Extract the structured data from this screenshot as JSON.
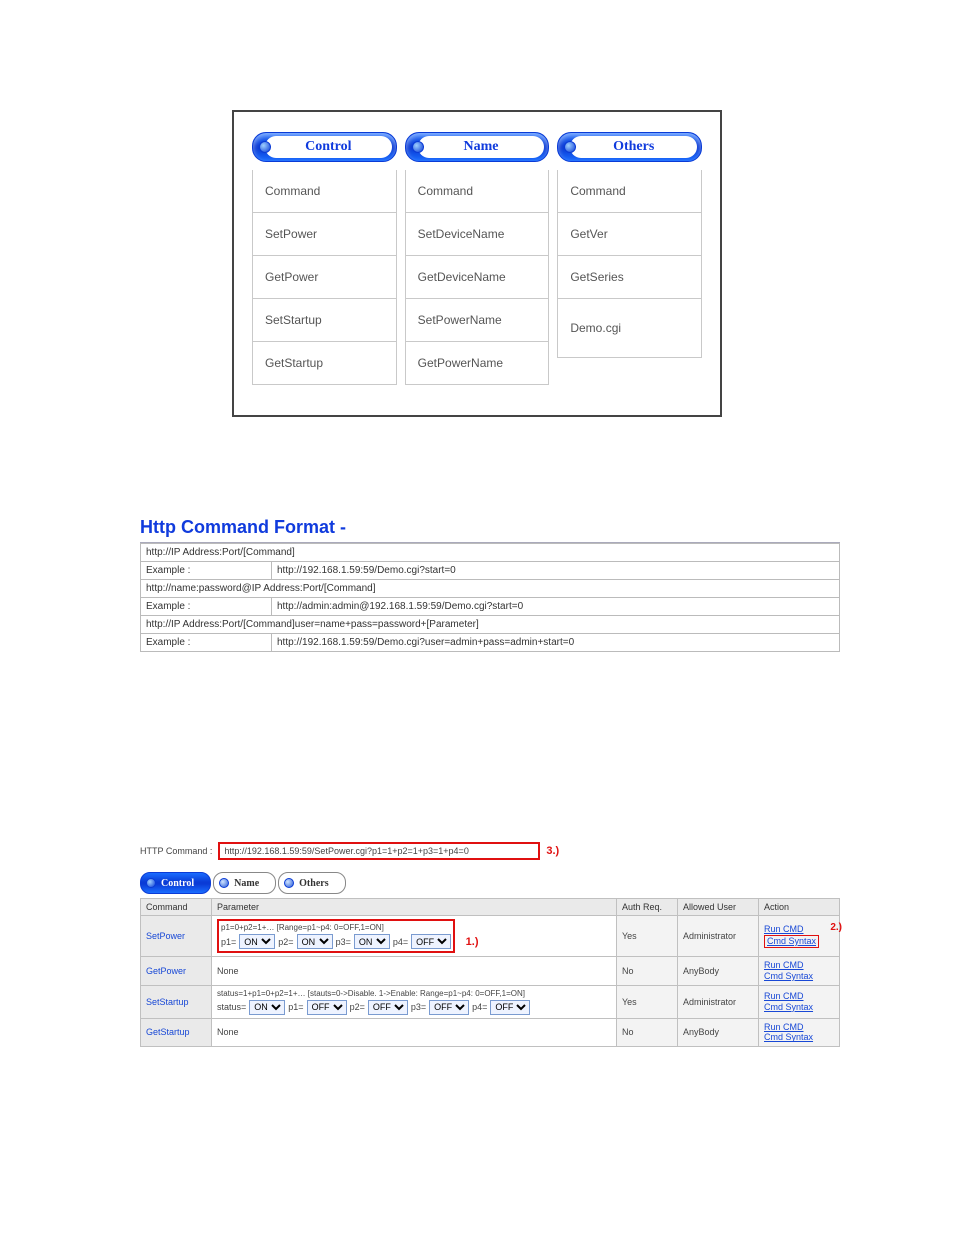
{
  "panel1": {
    "cols": [
      {
        "title": "Control",
        "rows": [
          "Command",
          "SetPower",
          "GetPower",
          "SetStartup",
          "GetStartup"
        ]
      },
      {
        "title": "Name",
        "rows": [
          "Command",
          "SetDeviceName",
          "GetDeviceName",
          "SetPowerName",
          "GetPowerName"
        ]
      },
      {
        "title": "Others",
        "rows": [
          "Command",
          "GetVer",
          "GetSeries",
          "Demo.cgi"
        ]
      }
    ]
  },
  "section2": {
    "title": "Http Command Format -",
    "rows": [
      {
        "span": "http://IP Address:Port/[Command]"
      },
      {
        "label": "Example :",
        "value": "http://192.168.1.59:59/Demo.cgi?start=0"
      },
      {
        "span": "http://name:password@IP Address:Port/[Command]"
      },
      {
        "label": "Example :",
        "value": "http://admin:admin@192.168.1.59:59/Demo.cgi?start=0"
      },
      {
        "span": "http://IP Address:Port/[Command]user=name+pass=password+[Parameter]"
      },
      {
        "label": "Example :",
        "value": "http://192.168.1.59:59/Demo.cgi?user=admin+pass=admin+start=0"
      }
    ]
  },
  "section3": {
    "http_label": "HTTP Command :",
    "http_url": "http://192.168.1.59:59/SetPower.cgi?p1=1+p2=1+p3=1+p4=0",
    "anno3": "3.)",
    "tabs": {
      "control": "Control",
      "name": "Name",
      "others": "Others"
    },
    "headers": {
      "command": "Command",
      "parameter": "Parameter",
      "auth": "Auth Req.",
      "user": "Allowed User",
      "action": "Action"
    },
    "links": {
      "run": "Run CMD",
      "syntax": "Cmd Syntax"
    },
    "anno1": "1.)",
    "anno2": "2.)",
    "rows": [
      {
        "cmd": "SetPower",
        "legend": "p1=0+p2=1+… [Range=p1~p4: 0=OFF,1=ON]",
        "selectors": [
          {
            "lbl": "p1=",
            "val": "ON"
          },
          {
            "lbl": "p2=",
            "val": "ON"
          },
          {
            "lbl": "p3=",
            "val": "ON"
          },
          {
            "lbl": "p4=",
            "val": "OFF"
          }
        ],
        "auth": "Yes",
        "user": "Administrator",
        "anno": "1"
      },
      {
        "cmd": "GetPower",
        "param_text": "None",
        "auth": "No",
        "user": "AnyBody"
      },
      {
        "cmd": "SetStartup",
        "legend": "status=1+p1=0+p2=1+… [stauts=0->Disable. 1->Enable: Range=p1~p4: 0=OFF,1=ON]",
        "selectors": [
          {
            "lbl": "status=",
            "val": "ON"
          },
          {
            "lbl": "p1=",
            "val": "OFF"
          },
          {
            "lbl": "p2=",
            "val": "OFF"
          },
          {
            "lbl": "p3=",
            "val": "OFF"
          },
          {
            "lbl": "p4=",
            "val": "OFF"
          }
        ],
        "auth": "Yes",
        "user": "Administrator"
      },
      {
        "cmd": "GetStartup",
        "param_text": "None",
        "auth": "No",
        "user": "AnyBody"
      }
    ]
  }
}
